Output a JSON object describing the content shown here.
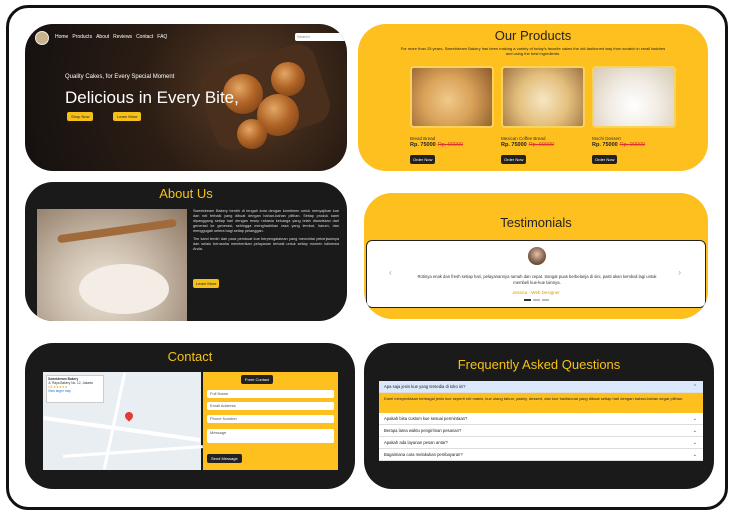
{
  "hero": {
    "nav": [
      "Home",
      "Products",
      "About",
      "Reviews",
      "Contact",
      "FAQ"
    ],
    "search_placeholder": "Search",
    "tagline": "Quality Cakes, for Every Special Moment",
    "headline": "Delicious in Every Bite,",
    "buttons": [
      "Shop Now",
      "Learn More"
    ]
  },
  "products": {
    "title": "Our Products",
    "description": "For more than 25 years, Sweetdream Bakery has been making a variety of today's favorite cakes the old-fashioned way from scratch in small batches and using the best ingredients.",
    "items": [
      {
        "name": "Bread Bread",
        "price": "Rp. 75000",
        "old_price": "Rp. 90000",
        "order": "Order Now"
      },
      {
        "name": "Mexican Coffee Bread",
        "price": "Rp. 75000",
        "old_price": "Rp. 90000",
        "order": "Order Now"
      },
      {
        "name": "Mochi Dessert",
        "price": "Rp. 75000",
        "old_price": "Rp. 90000",
        "order": "Order Now"
      }
    ]
  },
  "about": {
    "title": "About Us",
    "p1": "Sweetdream Bakery berdiri di tengah kota dengan komitmen untuk menyajikan kue dan roti terbaik yang dibuat dengan bahan-bahan pilihan. Setiap produk kami dipanggang setiap hari dengan resep rahasia keluarga yang telah diwariskan dari generasi ke generasi, sehingga menghadirkan rasa yang lembut, harum, dan menggugah selera bagi setiap pelanggan.",
    "p2": "Tim kami terdiri dari para pembuat kue berpengalaman yang mencintai pekerjaannya dan selalu berusaha memberikan pelayanan terbaik untuk setiap momen istimewa Anda.",
    "button": "Learn More"
  },
  "testimonials": {
    "title": "Testimonials",
    "quote": "Rotinya enak dan fresh setiap hari, pelayanannya ramah dan cepat. Sangat puas berbelanja di sini, pasti akan kembali lagi untuk membeli kue-kue lainnya.",
    "author": "Jessica - Web Designer",
    "prev": "‹",
    "next": "›"
  },
  "contact": {
    "title": "Contact",
    "map_place": "Sweetdream Bakery",
    "map_address": "Jl. Raya Bakery No. 12, Jakarta",
    "map_rating": "4.8 ★★★★★",
    "map_link": "View larger map",
    "form_title": "Form Contact",
    "fields": [
      "Full Name",
      "Email Address",
      "Phone Number",
      "Message"
    ],
    "send": "Send Message"
  },
  "faq": {
    "title": "Frequently Asked Questions",
    "answer": "Kami menyediakan berbagai jenis kue seperti roti manis, kue ulang tahun, pastry, dessert, dan kue tradisional yang dibuat setiap hari dengan bahan-bahan segar pilihan.",
    "questions": [
      "Apa saja jenis kue yang tersedia di toko ini?",
      "Apakah bisa custom kue sesuai permintaan?",
      "Berapa lama waktu pengiriman pesanan?",
      "Apakah ada layanan pesan antar?",
      "Bagaimana cara melakukan pembayaran?"
    ],
    "chevron_open": "⌃",
    "chevron_closed": "⌄"
  }
}
